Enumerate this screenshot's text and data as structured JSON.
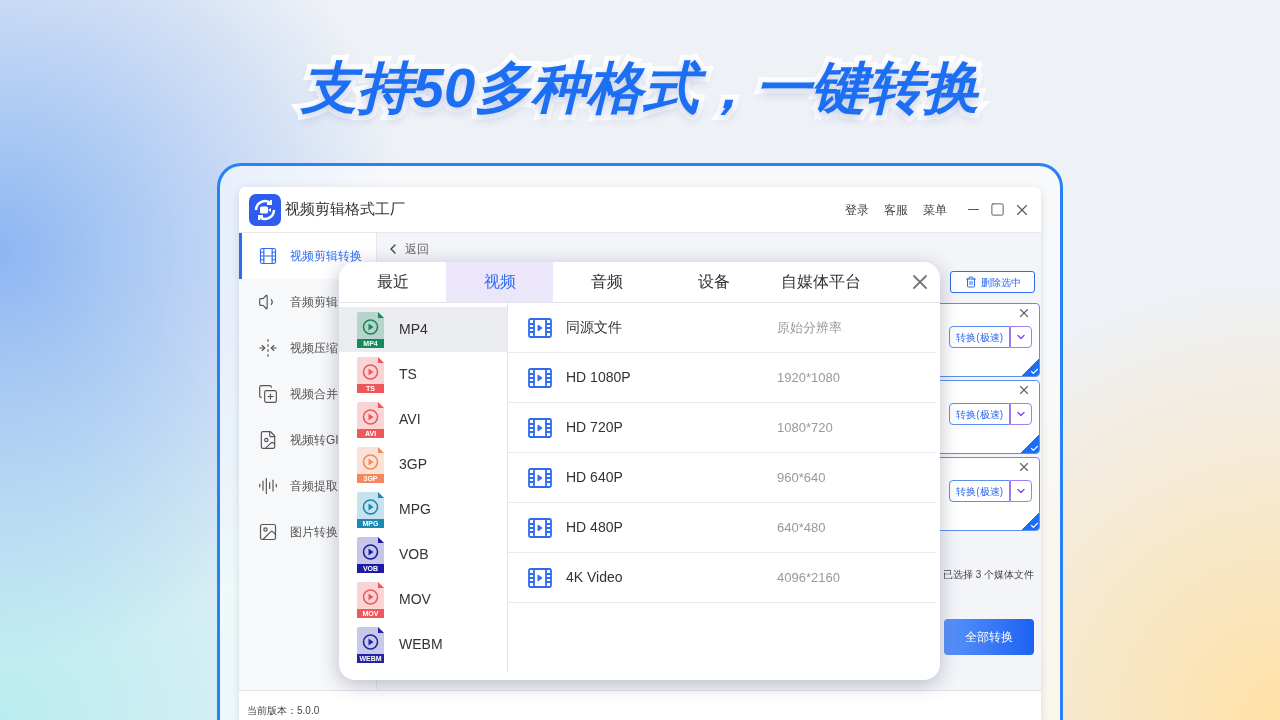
{
  "headline": "支持50多种格式，一键转换",
  "app": {
    "title": "视频剪辑格式工厂",
    "top_links": [
      "登录",
      "客服",
      "菜单"
    ],
    "sidebar": [
      {
        "label": "视频剪辑转换",
        "selected": true
      },
      {
        "label": "音频剪辑",
        "selected": false
      },
      {
        "label": "视频压缩",
        "selected": false
      },
      {
        "label": "视频合并",
        "selected": false
      },
      {
        "label": "视频转GI",
        "selected": false
      },
      {
        "label": "音频提取",
        "selected": false
      },
      {
        "label": "图片转换",
        "selected": false
      }
    ],
    "back": "返回",
    "delete_button": "删除选中",
    "files": [
      {
        "convert_label": "转换(极速)",
        "checked": true
      },
      {
        "convert_label": "转换(极速)",
        "checked": true
      },
      {
        "convert_label": "转换(极速)",
        "checked": true
      }
    ],
    "status": "已选择 3 个媒体文件",
    "convert_all": "全部转换",
    "version": "当前版本：5.0.0"
  },
  "modal": {
    "tabs": [
      {
        "label": "最近",
        "selected": false
      },
      {
        "label": "视频",
        "selected": true
      },
      {
        "label": "音频",
        "selected": false
      },
      {
        "label": "设备",
        "selected": false
      },
      {
        "label": "自媒体平台",
        "selected": false
      }
    ],
    "formats": [
      {
        "name": "MP4",
        "badge": "MP4",
        "color": "#178a5c",
        "selected": true
      },
      {
        "name": "TS",
        "badge": "TS",
        "color": "#f0575a",
        "selected": false
      },
      {
        "name": "AVI",
        "badge": "AVI",
        "color": "#f0575a",
        "selected": false
      },
      {
        "name": "3GP",
        "badge": "3GP",
        "color": "#f5895e",
        "selected": false
      },
      {
        "name": "MPG",
        "badge": "MPG",
        "color": "#1a8ab4",
        "selected": false
      },
      {
        "name": "VOB",
        "badge": "VOB",
        "color": "#1c1ca6",
        "selected": false
      },
      {
        "name": "MOV",
        "badge": "MOV",
        "color": "#f0575a",
        "selected": false
      },
      {
        "name": "WEBM",
        "badge": "WEBM",
        "color": "#2424a8",
        "selected": false
      }
    ],
    "presets": [
      {
        "name": "同源文件",
        "resolution": "原始分辨率"
      },
      {
        "name": "HD 1080P",
        "resolution": "1920*1080"
      },
      {
        "name": "HD 720P",
        "resolution": "1080*720"
      },
      {
        "name": "HD 640P",
        "resolution": "960*640"
      },
      {
        "name": "HD 480P",
        "resolution": "640*480"
      },
      {
        "name": "4K Video",
        "resolution": "4096*2160"
      }
    ]
  }
}
